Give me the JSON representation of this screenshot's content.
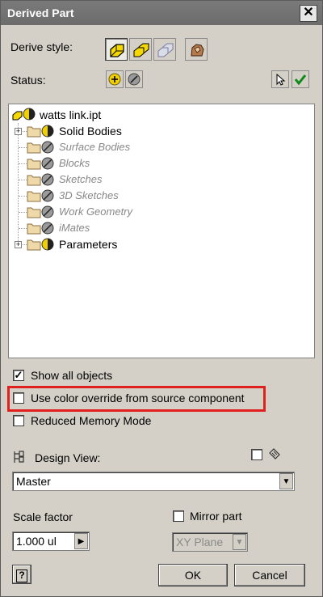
{
  "window": {
    "title": "Derived Part",
    "close_glyph": "✕"
  },
  "derive_style": {
    "label": "Derive style:"
  },
  "status": {
    "label": "Status:"
  },
  "tree": {
    "root": "watts link.ipt",
    "items": [
      {
        "label": "Solid Bodies",
        "enabled": true,
        "expandable": true
      },
      {
        "label": "Surface Bodies",
        "enabled": false,
        "expandable": false
      },
      {
        "label": "Blocks",
        "enabled": false,
        "expandable": false
      },
      {
        "label": "Sketches",
        "enabled": false,
        "expandable": false
      },
      {
        "label": "3D Sketches",
        "enabled": false,
        "expandable": false
      },
      {
        "label": "Work Geometry",
        "enabled": false,
        "expandable": false
      },
      {
        "label": "iMates",
        "enabled": false,
        "expandable": false
      },
      {
        "label": "Parameters",
        "enabled": true,
        "expandable": true
      }
    ]
  },
  "options": {
    "show_all_objects": {
      "label": "Show all objects",
      "checked": true
    },
    "use_color_override": {
      "label": "Use color override from source component",
      "checked": false
    },
    "reduced_memory": {
      "label": "Reduced Memory Mode",
      "checked": false
    }
  },
  "design_view": {
    "label": "Design View:",
    "value": "Master"
  },
  "scale": {
    "label": "Scale factor",
    "value": "1.000 ul"
  },
  "mirror": {
    "label": "Mirror part",
    "checked": false,
    "plane": "XY Plane"
  },
  "buttons": {
    "ok": "OK",
    "cancel": "Cancel",
    "help": "?"
  },
  "colors": {
    "highlight": "#e0201f",
    "check_green": "#0f8a1a",
    "folder": "#f0d9a8"
  }
}
